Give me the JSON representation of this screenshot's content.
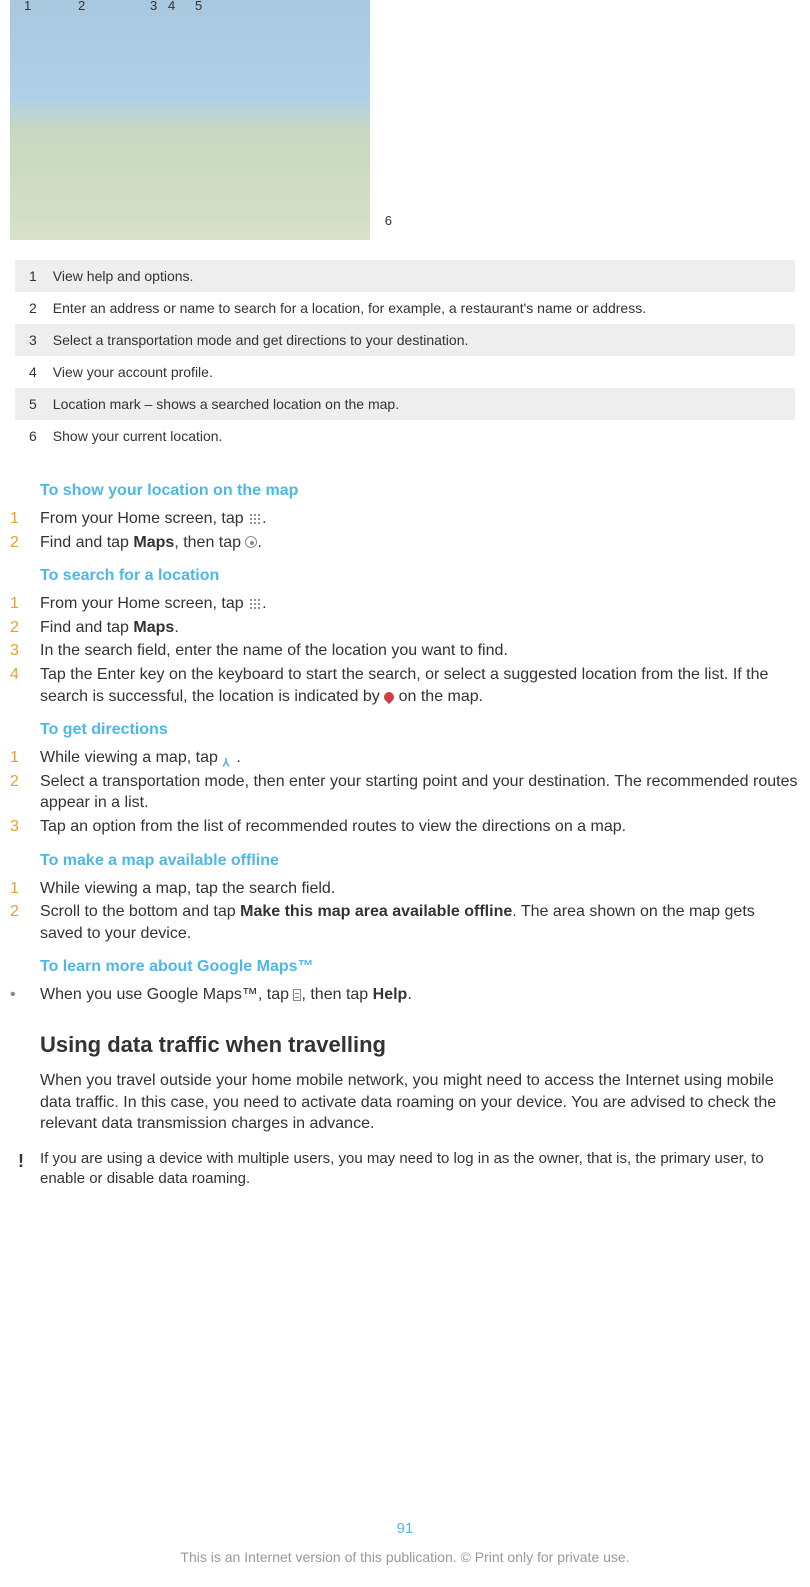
{
  "map_callouts": {
    "n1": "1",
    "n2": "2",
    "n3": "3",
    "n4": "4",
    "n5": "5",
    "n6": "6"
  },
  "legend": [
    {
      "num": "1",
      "text": "View help and options."
    },
    {
      "num": "2",
      "text": "Enter an address or name to search for a location, for example, a restaurant's name or address."
    },
    {
      "num": "3",
      "text": "Select a transportation mode and get directions to your destination."
    },
    {
      "num": "4",
      "text": "View your account profile."
    },
    {
      "num": "5",
      "text": "Location mark – shows a searched location on the map."
    },
    {
      "num": "6",
      "text": "Show your current location."
    }
  ],
  "sec_show_location": {
    "heading": "To show your location on the map",
    "s1": {
      "n": "1",
      "a": "From your Home screen, tap ",
      "b": "."
    },
    "s2": {
      "n": "2",
      "a": "Find and tap ",
      "maps": "Maps",
      "b": ", then tap ",
      "c": "."
    }
  },
  "sec_search": {
    "heading": "To search for a location",
    "s1": {
      "n": "1",
      "a": "From your Home screen, tap ",
      "b": "."
    },
    "s2": {
      "n": "2",
      "a": "Find and tap ",
      "maps": "Maps",
      "b": "."
    },
    "s3": {
      "n": "3",
      "a": "In the search field, enter the name of the location you want to find."
    },
    "s4": {
      "n": "4",
      "a": "Tap the Enter key on the keyboard to start the search, or select a suggested location from the list. If the search is successful, the location is indicated by ",
      "b": " on the map."
    }
  },
  "sec_directions": {
    "heading": "To get directions",
    "s1": {
      "n": "1",
      "a": "While viewing a map, tap ",
      "b": "."
    },
    "s2": {
      "n": "2",
      "a": "Select a transportation mode, then enter your starting point and your destination. The recommended routes appear in a list."
    },
    "s3": {
      "n": "3",
      "a": "Tap an option from the list of recommended routes to view the directions on a map."
    }
  },
  "sec_offline": {
    "heading": "To make a map available offline",
    "s1": {
      "n": "1",
      "a": "While viewing a map, tap the search field."
    },
    "s2": {
      "n": "2",
      "a": "Scroll to the bottom and tap ",
      "bold": "Make this map area available offline",
      "b": ". The area shown on the map gets saved to your device."
    }
  },
  "sec_learn": {
    "heading": "To learn more about Google Maps™",
    "s1": {
      "a": "When you use Google Maps™, tap ",
      "b": ", then tap ",
      "help": "Help",
      "c": "."
    }
  },
  "main_heading": "Using data traffic when travelling",
  "body": "When you travel outside your home mobile network, you might need to access the Internet using mobile data traffic. In this case, you need to activate data roaming on your device. You are advised to check the relevant data transmission charges in advance.",
  "note": "If you are using a device with multiple users, you may need to log in as the owner, that is, the primary user, to enable or disable data roaming.",
  "page_num": "91",
  "footer": "This is an Internet version of this publication. © Print only for private use."
}
